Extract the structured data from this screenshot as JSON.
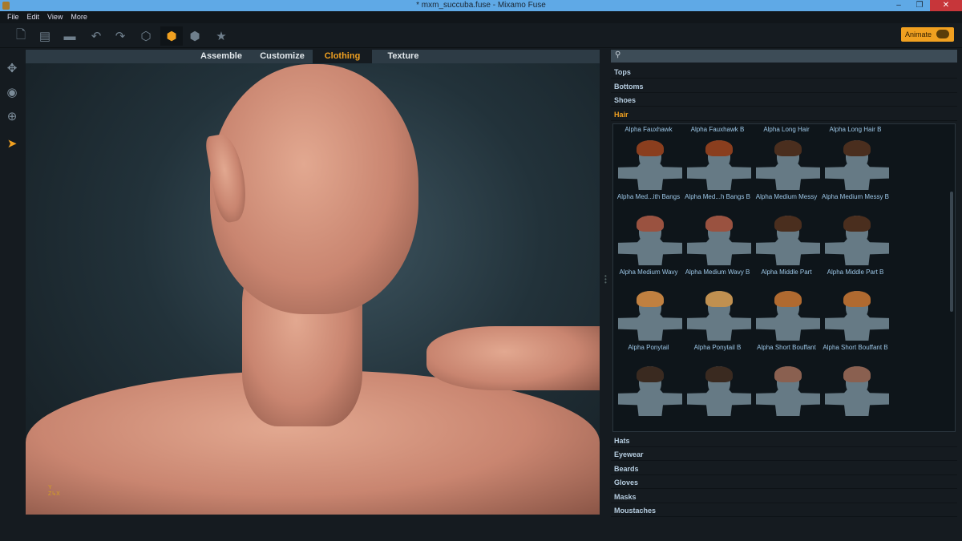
{
  "window": {
    "title": "* mxm_succuba.fuse - Mixamo Fuse",
    "minimize": "–",
    "maximize": "❐",
    "close": "✕"
  },
  "menu": [
    "File",
    "Edit",
    "View",
    "More"
  ],
  "toolbar": {
    "buttons": [
      "new-file-icon",
      "open-folder-icon",
      "save-icon",
      "undo-icon",
      "redo-icon",
      "assemble-cube-icon",
      "textured-cube-icon",
      "solid-cube-icon",
      "star-icon"
    ],
    "active": "textured-cube-icon",
    "animate_label": "Animate",
    "accent": "#f0a020"
  },
  "left_tools": [
    "move-icon",
    "rotate-icon",
    "target-icon",
    "pointer-icon"
  ],
  "tabs": [
    {
      "label": "Assemble"
    },
    {
      "label": "Customize"
    },
    {
      "label": "Clothing",
      "active": true
    },
    {
      "label": "Texture"
    }
  ],
  "viewport": {
    "axis": {
      "y": "Y",
      "x": "X",
      "z": "Z"
    }
  },
  "search": {
    "placeholder": ""
  },
  "categories_top": [
    "Tops",
    "Bottoms",
    "Shoes",
    "Hair"
  ],
  "active_category": "Hair",
  "hair_partial": [
    "Alpha Fauxhawk",
    "Alpha Fauxhawk B",
    "Alpha Long Hair",
    "Alpha Long Hair B"
  ],
  "hair_items": [
    {
      "name": "Alpha Med...ith Bangs",
      "color": "#8a3e1e"
    },
    {
      "name": "Alpha Med...h Bangs B",
      "color": "#8a3e1e"
    },
    {
      "name": "Alpha Medium Messy",
      "color": "#4a2e1e"
    },
    {
      "name": "Alpha Medium Messy B",
      "color": "#4a2e1e"
    },
    {
      "name": "Alpha Medium Wavy",
      "color": "#9a5240"
    },
    {
      "name": "Alpha Medium Wavy B",
      "color": "#9a5240"
    },
    {
      "name": "Alpha Middle Part",
      "color": "#4a2e1e"
    },
    {
      "name": "Alpha Middle Part B",
      "color": "#4a2e1e"
    },
    {
      "name": "Alpha Ponytail",
      "color": "#c08040"
    },
    {
      "name": "Alpha Ponytail B",
      "color": "#c09050"
    },
    {
      "name": "Alpha Short Bouffant",
      "color": "#b06a30"
    },
    {
      "name": "Alpha Short Bouffant B",
      "color": "#b06a30"
    },
    {
      "name": "",
      "color": "#3a2a20"
    },
    {
      "name": "",
      "color": "#3a2a20"
    },
    {
      "name": "",
      "color": "#8a6050"
    },
    {
      "name": "",
      "color": "#8a6050"
    }
  ],
  "categories_bottom": [
    "Hats",
    "Eyewear",
    "Beards",
    "Gloves",
    "Masks",
    "Moustaches"
  ]
}
